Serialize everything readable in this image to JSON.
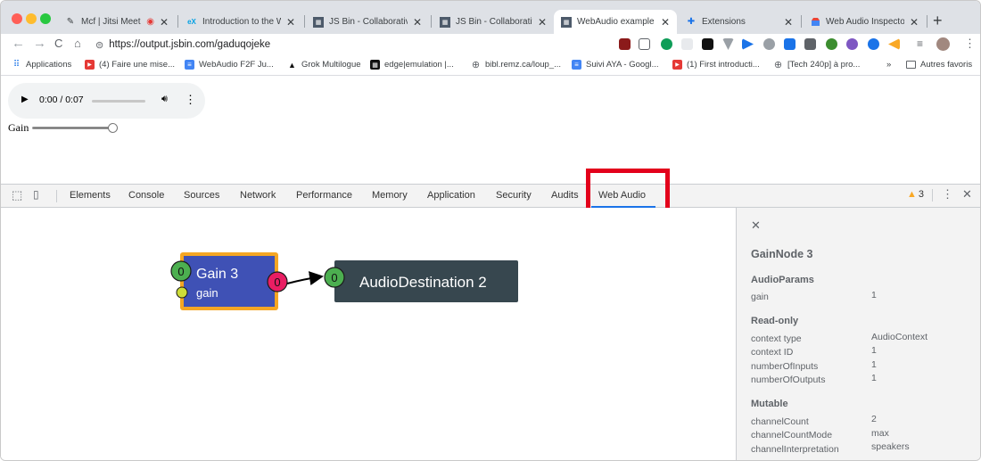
{
  "tabs": [
    {
      "title": "Mcf | Jitsi Meet",
      "icon": "jitsi-icon"
    },
    {
      "title": "Introduction to the We",
      "icon": "edx-icon"
    },
    {
      "title": "JS Bin - Collaborative",
      "icon": "jsbin-icon"
    },
    {
      "title": "JS Bin - Collaborative",
      "icon": "jsbin-icon"
    },
    {
      "title": "WebAudio example of",
      "icon": "jsbin-icon"
    },
    {
      "title": "Extensions",
      "icon": "puzzle-icon"
    },
    {
      "title": "Web Audio Inspector",
      "icon": "chrome-store-icon"
    }
  ],
  "address": {
    "url": "https://output.jsbin.com/gaduqojeke"
  },
  "bookmarks": [
    {
      "label": "Applications"
    },
    {
      "label": "(4) Faire une mise..."
    },
    {
      "label": "WebAudio F2F Ju..."
    },
    {
      "label": "Grok Multilogue"
    },
    {
      "label": "edge|emulation |..."
    },
    {
      "label": "bibl.remz.ca/loup_..."
    },
    {
      "label": "Suivi AYA - Googl..."
    },
    {
      "label": "(1) First introducti..."
    },
    {
      "label": "[Tech 240p] à pro..."
    },
    {
      "label": "»"
    },
    {
      "label": "Autres favoris"
    }
  ],
  "page": {
    "audio": {
      "time": "0:00 / 0:07",
      "progress": 0,
      "volume": 0.9
    },
    "gain_label": "Gain",
    "gain_value": 1
  },
  "devtools": {
    "tabs": [
      "Elements",
      "Console",
      "Sources",
      "Network",
      "Performance",
      "Memory",
      "Application",
      "Security",
      "Audits",
      "Web Audio"
    ],
    "active_tab": "Web Audio",
    "warning_count": "3",
    "graph": {
      "gain_node": {
        "title": "Gain 3",
        "param": "gain",
        "in_port": "0",
        "out_port": "0"
      },
      "dest_node": {
        "title": "AudioDestination 2",
        "in_port": "0"
      }
    },
    "panel": {
      "title": "GainNode 3",
      "sections": [
        {
          "heading": "AudioParams",
          "rows": [
            {
              "key": "gain",
              "value": "1"
            }
          ]
        },
        {
          "heading": "Read-only",
          "rows": [
            {
              "key": "context type",
              "value": "AudioContext"
            },
            {
              "key": "context ID",
              "value": "1"
            },
            {
              "key": "numberOfInputs",
              "value": "1"
            },
            {
              "key": "numberOfOutputs",
              "value": "1"
            }
          ]
        },
        {
          "heading": "Mutable",
          "rows": [
            {
              "key": "channelCount",
              "value": "2"
            },
            {
              "key": "channelCountMode",
              "value": "max"
            },
            {
              "key": "channelInterpretation",
              "value": "speakers"
            }
          ]
        }
      ]
    }
  },
  "colors": {
    "gain_fill": "#3f51b5",
    "gain_border": "#f5a623",
    "dest_fill": "#37474f",
    "input_port": "#4caf50",
    "output_port": "#e91e63",
    "param_port": "#cddc39",
    "highlight": "#e3001b",
    "active_tab_underline": "#1a73e8"
  }
}
